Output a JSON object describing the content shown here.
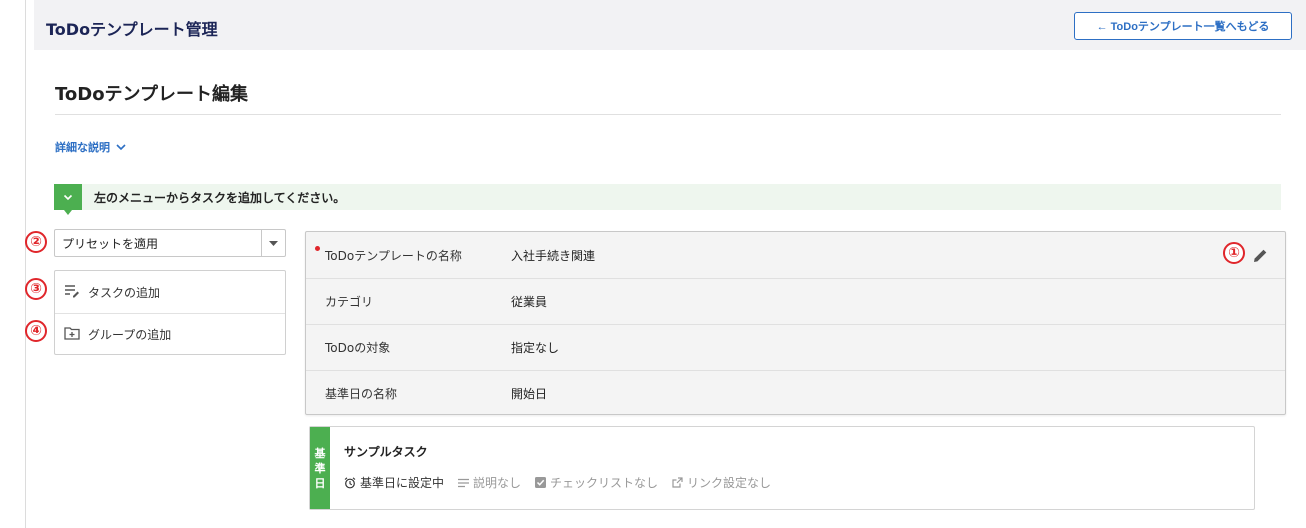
{
  "header": {
    "app_title": "ToDoテンプレート管理",
    "back_button": "← ToDoテンプレート一覧へもどる"
  },
  "page": {
    "title": "ToDoテンプレート編集",
    "detail_link": "詳細な説明"
  },
  "notice": {
    "text": "左のメニューからタスクを追加してください。"
  },
  "markers": [
    "①",
    "②",
    "③",
    "④"
  ],
  "sidebar": {
    "preset_select": "プリセットを適用",
    "add_task": "タスクの追加",
    "add_group": "グループの追加"
  },
  "template_info": {
    "rows": [
      {
        "label": "ToDoテンプレートの名称",
        "value": "入社手続き関連",
        "required": true
      },
      {
        "label": "カテゴリ",
        "value": "従業員"
      },
      {
        "label": "ToDoの対象",
        "value": "指定なし"
      },
      {
        "label": "基準日の名称",
        "value": "開始日"
      }
    ]
  },
  "task": {
    "side_label": [
      "基",
      "準",
      "日"
    ],
    "title": "サンプルタスク",
    "meta": {
      "base_date": "基準日に設定中",
      "description": "説明なし",
      "checklist": "チェックリストなし",
      "link": "リンク設定なし"
    }
  },
  "colors": {
    "accent_blue": "#2d6fc4",
    "header_navy": "#1c2556",
    "green": "#4caf50",
    "marker_red": "#e0262b"
  },
  "icons": [
    "arrow-left-icon",
    "chevron-down-icon",
    "caret-down-icon",
    "task-add-icon",
    "folder-add-icon",
    "pencil-icon",
    "alarm-icon",
    "lines-icon",
    "checkbox-icon",
    "external-link-icon"
  ]
}
